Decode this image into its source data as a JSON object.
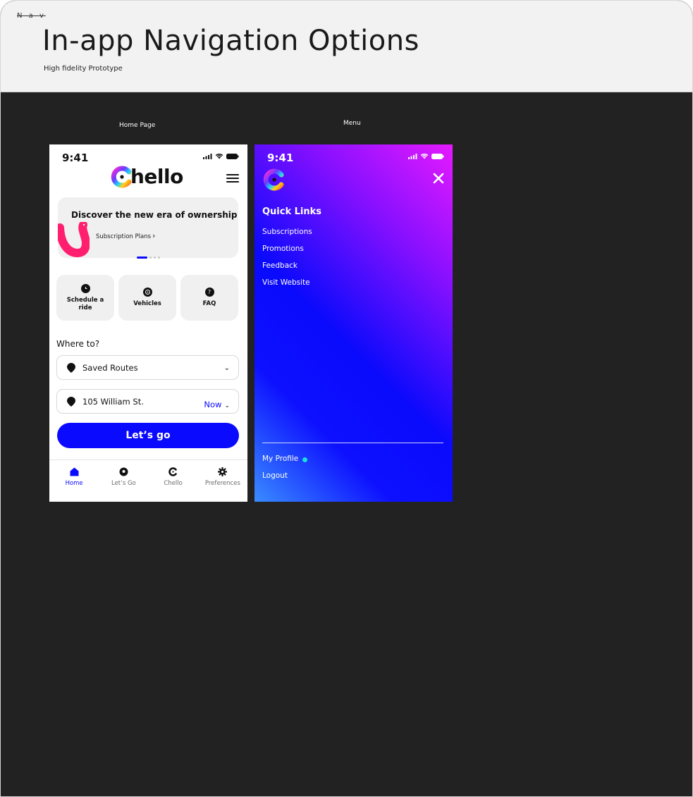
{
  "header": {
    "tag": "N a v",
    "title": "In-app Navigation Options",
    "subtitle": "High fidelity Prototype"
  },
  "frames": {
    "home_label": "Home Page",
    "menu_label": "Menu"
  },
  "home": {
    "time": "9:41",
    "brand": "hello",
    "promo": {
      "title": "Discover the new era of ownership!",
      "link": "Subscription Plans"
    },
    "tiles": [
      {
        "label": "Schedule a ride",
        "icon": "clock-icon"
      },
      {
        "label": "Vehicles",
        "icon": "steering-wheel-icon"
      },
      {
        "label": "FAQ",
        "icon": "question-icon"
      }
    ],
    "where_label": "Where to?",
    "saved_routes": "Saved Routes",
    "destination": "105 William St.",
    "time_choice": "Now",
    "cta": "Let’s go",
    "tabs": [
      {
        "label": "Home",
        "icon": "home-icon",
        "active": true
      },
      {
        "label": "Let’s Go",
        "icon": "location-pin-icon",
        "active": false
      },
      {
        "label": "Chello",
        "icon": "chello-logo-icon",
        "active": false
      },
      {
        "label": "Preferences",
        "icon": "gear-icon",
        "active": false
      }
    ]
  },
  "menu": {
    "time": "9:41",
    "section_title": "Quick Links",
    "links": [
      "Subscriptions",
      "Promotions",
      "Feedback",
      "Visit Website"
    ],
    "profile": "My Profile",
    "logout": "Logout"
  },
  "colors": {
    "accent": "#0a0aff",
    "canvas": "#222222",
    "online": "#19e0d8",
    "promo_art": "#ff1f6e"
  }
}
